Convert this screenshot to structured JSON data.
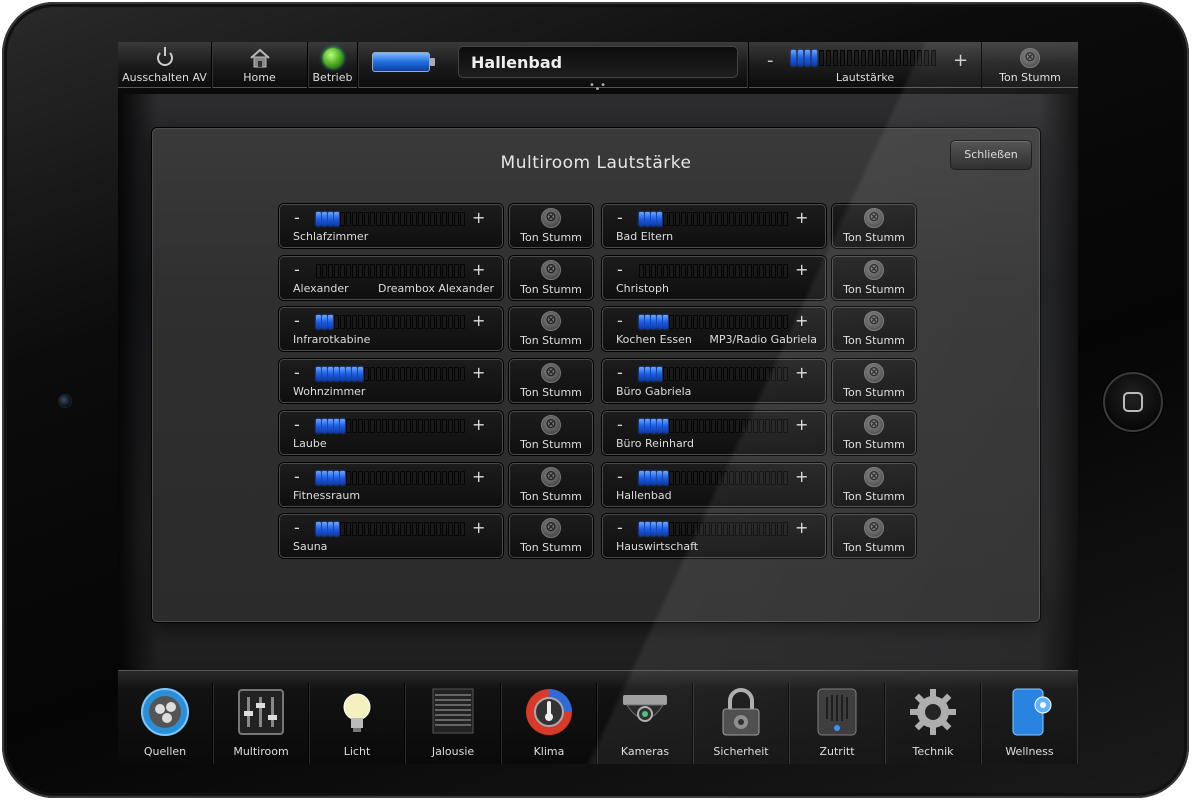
{
  "topbar": {
    "power_label": "Ausschalten AV",
    "home_label": "Home",
    "status_label": "Betrieb",
    "room_title": "Hallenbad",
    "volume_minus": "-",
    "volume_plus": "+",
    "volume_label": "Lautstärke",
    "volume_level": 4,
    "mute_label": "Ton Stumm"
  },
  "panel": {
    "title": "Multiroom Lautstärke",
    "close_label": "Schließen",
    "minus": "-",
    "plus": "+",
    "mute_label": "Ton Stumm",
    "mute_glyph": "⊗",
    "rooms_left": [
      {
        "name": "Schlafzimmer",
        "source": "",
        "level": 4
      },
      {
        "name": "Alexander",
        "source": "Dreambox Alexander",
        "level": 0
      },
      {
        "name": "Infrarotkabine",
        "source": "",
        "level": 3
      },
      {
        "name": "Wohnzimmer",
        "source": "",
        "level": 8
      },
      {
        "name": "Laube",
        "source": "",
        "level": 5
      },
      {
        "name": "Fitnessraum",
        "source": "",
        "level": 5
      },
      {
        "name": "Sauna",
        "source": "",
        "level": 4
      }
    ],
    "rooms_right": [
      {
        "name": "Bad Eltern",
        "source": "",
        "level": 4
      },
      {
        "name": "Christoph",
        "source": "",
        "level": 0
      },
      {
        "name": "Kochen Essen",
        "source": "MP3/Radio Gabriela",
        "level": 5
      },
      {
        "name": "Büro Gabriela",
        "source": "",
        "level": 4
      },
      {
        "name": "Büro Reinhard",
        "source": "",
        "level": 5
      },
      {
        "name": "Hallenbad",
        "source": "",
        "level": 5
      },
      {
        "name": "Hauswirtschaft",
        "source": "",
        "level": 5
      }
    ]
  },
  "nav": [
    {
      "label": "Quellen",
      "icon": "sources-icon"
    },
    {
      "label": "Multiroom",
      "icon": "multiroom-mixer-icon"
    },
    {
      "label": "Licht",
      "icon": "lightbulb-icon"
    },
    {
      "label": "Jalousie",
      "icon": "blinds-icon"
    },
    {
      "label": "Klima",
      "icon": "thermometer-icon"
    },
    {
      "label": "Kameras",
      "icon": "camera-icon"
    },
    {
      "label": "Sicherheit",
      "icon": "padlock-icon"
    },
    {
      "label": "Zutritt",
      "icon": "intercom-icon"
    },
    {
      "label": "Technik",
      "icon": "gear-icon"
    },
    {
      "label": "Wellness",
      "icon": "wellness-icon"
    }
  ]
}
